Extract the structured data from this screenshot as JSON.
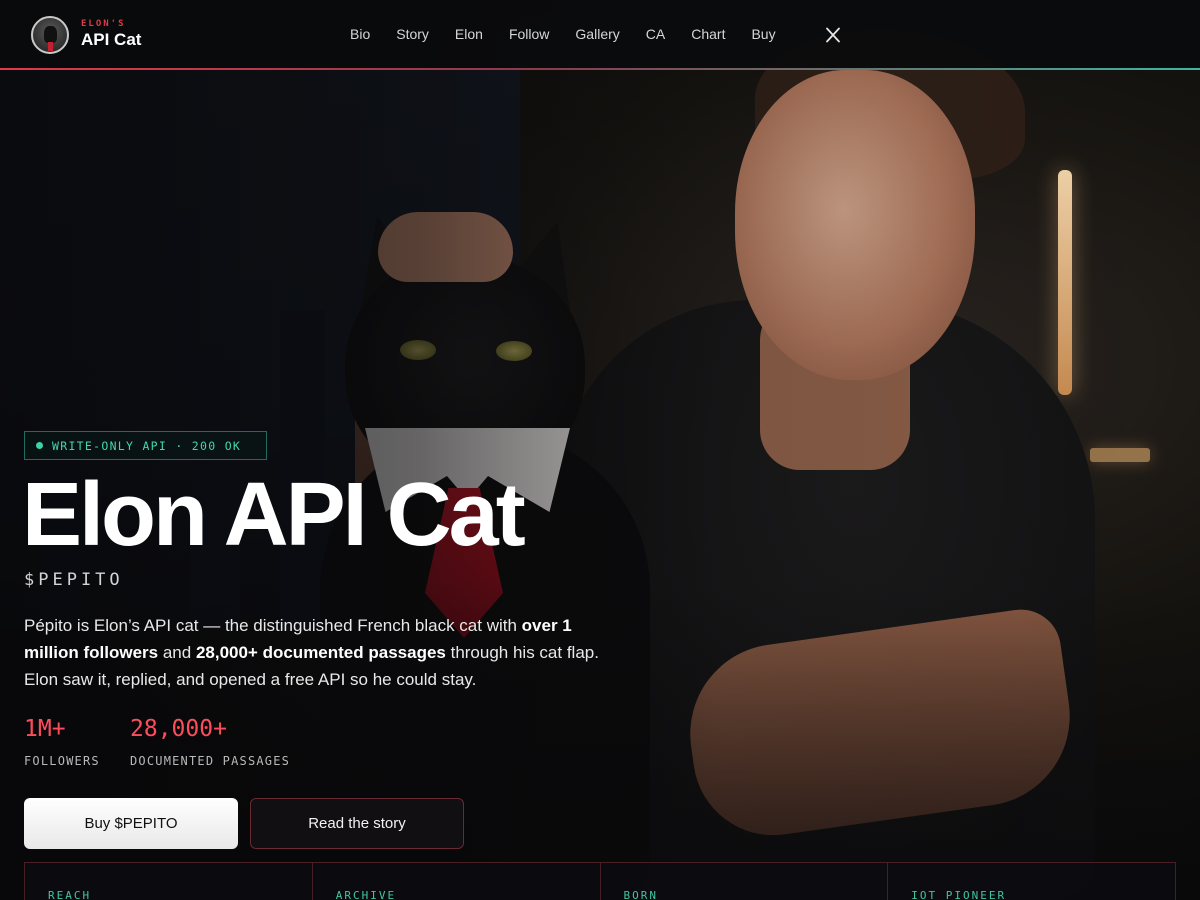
{
  "brand": {
    "kicker": "ELON'S",
    "name": "API Cat",
    "accent_red": "#e0394a",
    "accent_teal": "#3fb6a0"
  },
  "nav": {
    "links": [
      "Bio",
      "Story",
      "Elon",
      "Follow",
      "Gallery",
      "CA",
      "Chart",
      "Buy"
    ],
    "social_icon": "x-icon"
  },
  "hero": {
    "status_pill": "WRITE-ONLY API · 200 OK",
    "title": "Elon API Cat",
    "ticker": "$PEPITO",
    "description": {
      "part1": "Pépito is Elon’s API cat — the distinguished French black cat with ",
      "bold1": "over 1 million followers",
      "part2": " and ",
      "bold2": "28,000+ documented passages",
      "part3": " through his cat flap. Elon saw it, replied, and opened a free API so he could stay."
    },
    "stats": [
      {
        "value": "1M+",
        "label": "FOLLOWERS"
      },
      {
        "value": "28,000+",
        "label": "DOCUMENTED PASSAGES"
      }
    ],
    "buttons": {
      "primary": "Buy $PEPITO",
      "secondary": "Read the story"
    }
  },
  "cards": [
    {
      "label": "REACH"
    },
    {
      "label": "ARCHIVE"
    },
    {
      "label": "BORN"
    },
    {
      "label": "IOT PIONEER"
    }
  ]
}
